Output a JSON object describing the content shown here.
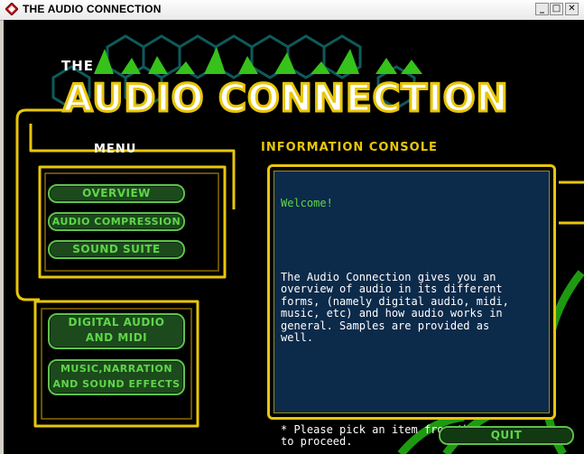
{
  "window": {
    "title": "THE AUDIO CONNECTION",
    "min": "_",
    "max": "□",
    "close": "✕"
  },
  "logo": {
    "the": "THE",
    "main": "AUDIO CONNECTION"
  },
  "menu": {
    "heading": "MENU",
    "items": [
      {
        "label": "OVERVIEW"
      },
      {
        "label": "AUDIO COMPRESSION"
      },
      {
        "label": "SOUND SUITE"
      }
    ],
    "items2": [
      {
        "line1": "DIGITAL AUDIO",
        "line2": "AND MIDI"
      },
      {
        "line1": "MUSIC,NARRATION",
        "line2": "AND SOUND EFFECTS"
      }
    ]
  },
  "console": {
    "heading": "INFORMATION CONSOLE",
    "welcome": "Welcome!",
    "body": "The Audio Connection gives you an\noverview of audio in its different\nforms, (namely digital audio, midi,\nmusic, etc) and how audio works in\ngeneral. Samples are provided as\nwell.",
    "hint": "* Please pick an item from the menu\nto proceed."
  },
  "quit": {
    "label": "QUIT"
  },
  "colors": {
    "accent_green": "#5fd64a",
    "gold": "#e8c60a",
    "console_bg": "#0c2a4a"
  }
}
